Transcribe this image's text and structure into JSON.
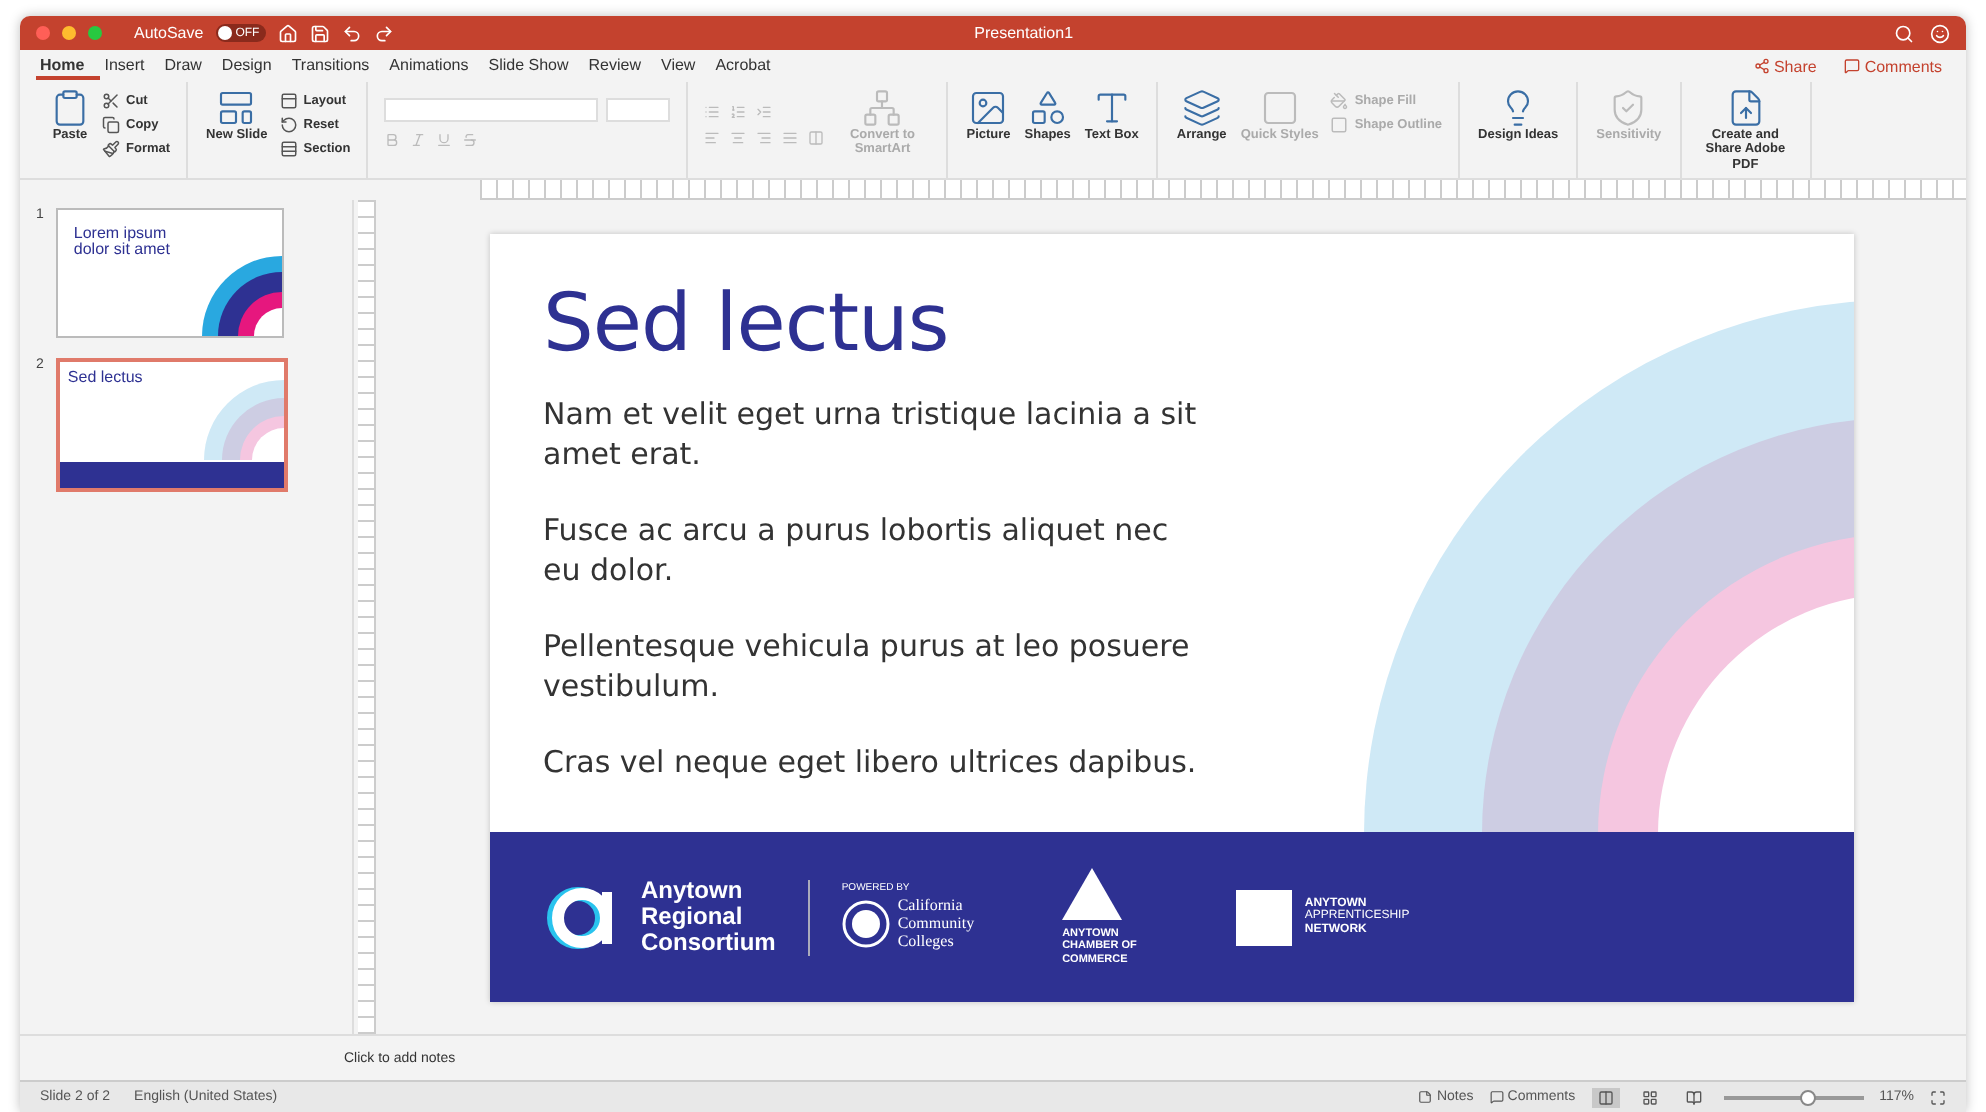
{
  "window": {
    "title": "Presentation1",
    "autosave": {
      "label": "AutoSave",
      "on": false,
      "state_text": "OFF"
    }
  },
  "ribbon_tabs": [
    {
      "label": "Home",
      "selected": true
    },
    {
      "label": "Insert",
      "selected": false
    },
    {
      "label": "Draw",
      "selected": false
    },
    {
      "label": "Design",
      "selected": false
    },
    {
      "label": "Transitions",
      "selected": false
    },
    {
      "label": "Animations",
      "selected": false
    },
    {
      "label": "Slide Show",
      "selected": false
    },
    {
      "label": "Review",
      "selected": false
    },
    {
      "label": "View",
      "selected": false
    },
    {
      "label": "Acrobat",
      "selected": false
    }
  ],
  "share": "Share",
  "comments": "Comments",
  "ribbon_groups": [
    {
      "columns": [
        {
          "kind": "large",
          "label": "Paste",
          "disabled": false
        },
        {
          "kind": "stack",
          "items": [
            {
              "label": "Cut",
              "disabled": false
            },
            {
              "label": "Copy",
              "disabled": false
            },
            {
              "label": "Format",
              "disabled": false
            }
          ]
        }
      ]
    },
    {
      "columns": [
        {
          "kind": "large",
          "label": "New Slide",
          "disabled": false
        },
        {
          "kind": "stack",
          "items": [
            {
              "label": "Layout",
              "disabled": false
            },
            {
              "label": "Reset",
              "disabled": false
            },
            {
              "label": "Section",
              "disabled": false
            }
          ]
        }
      ]
    },
    {
      "columns": [
        {
          "kind": "font",
          "disabled": true
        }
      ]
    },
    {
      "columns": [
        {
          "kind": "paragraph",
          "disabled": true
        },
        {
          "kind": "large",
          "label": "Convert to SmartArt",
          "disabled": true
        }
      ]
    },
    {
      "columns": [
        {
          "kind": "large",
          "label": "Picture",
          "disabled": false
        },
        {
          "kind": "large",
          "label": "Shapes",
          "disabled": false
        },
        {
          "kind": "large",
          "label": "Text Box",
          "disabled": false
        }
      ]
    },
    {
      "columns": [
        {
          "kind": "large",
          "label": "Arrange",
          "disabled": false
        },
        {
          "kind": "large",
          "label": "Quick Styles",
          "disabled": true
        },
        {
          "kind": "stack",
          "items": [
            {
              "label": "Shape Fill",
              "disabled": true
            },
            {
              "label": "Shape Outline",
              "disabled": true
            }
          ]
        }
      ]
    },
    {
      "columns": [
        {
          "kind": "large",
          "label": "Design Ideas",
          "disabled": false
        }
      ]
    },
    {
      "columns": [
        {
          "kind": "large",
          "label": "Sensitivity",
          "disabled": true
        }
      ]
    },
    {
      "columns": [
        {
          "kind": "large",
          "label": "Create and Share Adobe PDF",
          "disabled": false
        }
      ]
    }
  ],
  "thumbnails": [
    {
      "number": "1",
      "title": "Lorem ipsum dolor sit amet",
      "selected": false,
      "kind": "cover"
    },
    {
      "number": "2",
      "title": "Sed lectus",
      "selected": true,
      "kind": "content"
    }
  ],
  "slide": {
    "title": "Sed lectus",
    "paragraphs": [
      "Nam et velit eget urna tristique lacinia a sit amet erat.",
      "Fusce ac arcu a purus lobortis aliquet nec eu dolor.",
      "Pellentesque vehicula purus at leo posuere vestibulum.",
      "Cras vel neque eget libero ultrices dapibus."
    ],
    "footer": {
      "consortium": [
        "Anytown",
        "Regional",
        "Consortium"
      ],
      "powered_by": "POWERED BY",
      "college": [
        "California",
        "Community",
        "Colleges"
      ],
      "chamber": [
        "ANYTOWN",
        "CHAMBER OF",
        "COMMERCE"
      ],
      "network": [
        "ANYTOWN",
        "APPRENTICESHIP",
        "NETWORK"
      ]
    }
  },
  "notes": {
    "placeholder": "Click to add notes"
  },
  "status_bar": {
    "slide": "Slide 2 of 2",
    "language": "English (United States)",
    "notes": "Notes",
    "comments": "Comments",
    "views": [
      {
        "selected": true
      },
      {
        "selected": false
      },
      {
        "selected": false
      }
    ],
    "zoom": {
      "level": 0.6
    },
    "zoom_text": "117%"
  }
}
